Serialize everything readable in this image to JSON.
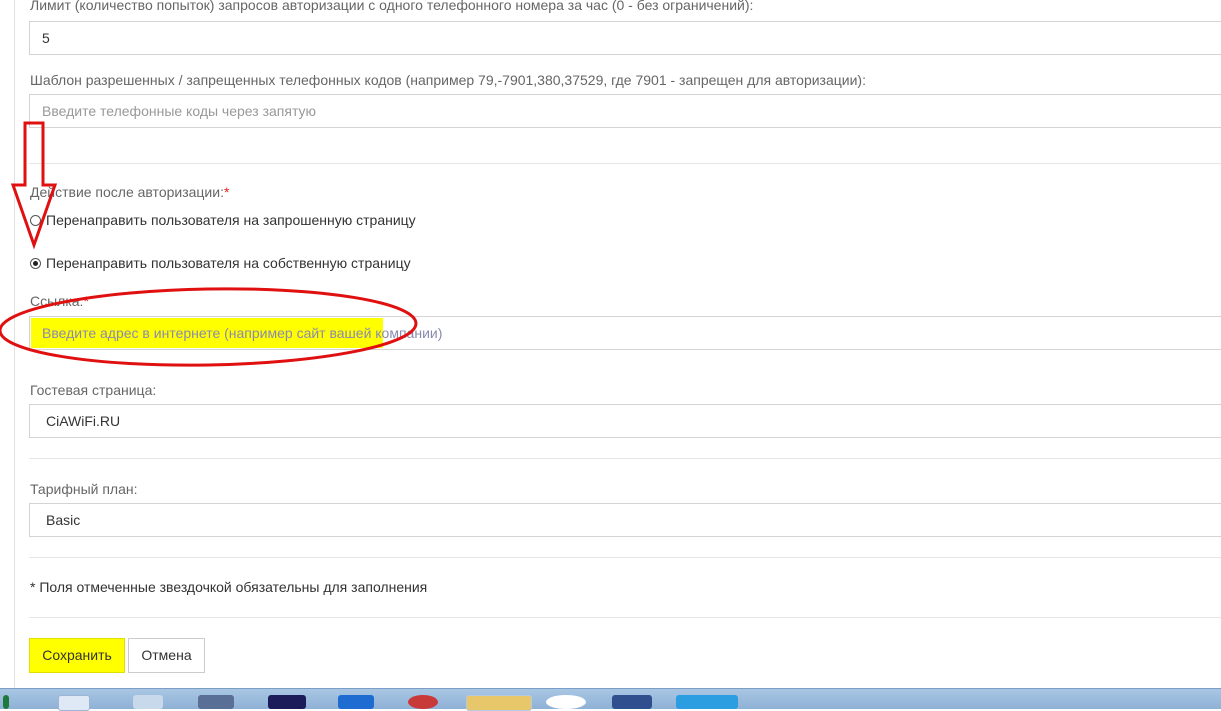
{
  "form": {
    "limit_label": "Лимит (количество попыток) запросов авторизации с одного телефонного номера за час (0 - без ограничений):",
    "limit_value": "5",
    "codes_label": "Шаблон разрешенных / запрещенных телефонных кодов (например 79,-7901,380,37529, где 7901 - запрещен для авторизации):",
    "codes_placeholder": "Введите телефонные коды через запятую",
    "action_label": "Действие после авторизации:",
    "required_mark": "*",
    "radio_requested": "Перенаправить пользователя на запрошенную страницу",
    "radio_own": "Перенаправить пользователя на собственную страницу",
    "link_label": "Ссылка:",
    "link_placeholder": "Введите адрес в интернете (например сайт вашей компании)",
    "guest_label": "Гостевая страница:",
    "guest_value": "CiAWiFi.RU",
    "tariff_label": "Тарифный план:",
    "tariff_value": "Basic",
    "required_note": "* Поля отмеченные звездочкой обязательны для заполнения",
    "save_button": "Сохранить",
    "cancel_button": "Отмена"
  },
  "annotations": {
    "color": "#e01010",
    "highlight_color": "#ffff00"
  },
  "taskbar": {
    "icons": [
      "ie-icon",
      "media-icon",
      "keyboard-icon",
      "visual-studio-icon",
      "windows-icon",
      "clock-icon",
      "folder-icon",
      "chrome-icon",
      "app-icon",
      "skype-icon"
    ]
  }
}
